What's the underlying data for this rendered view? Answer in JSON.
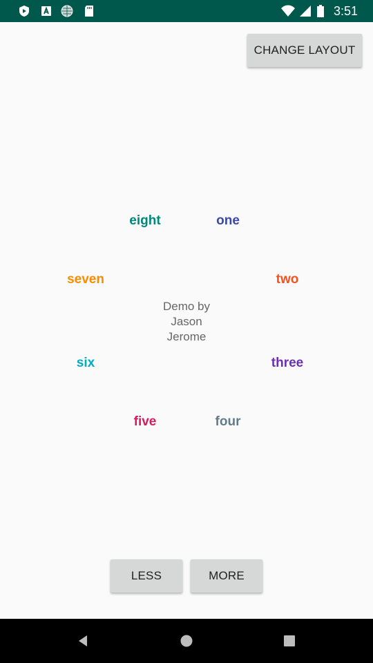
{
  "status_bar": {
    "time": "3:51",
    "left_icons": [
      "play-protect-icon",
      "font-a-icon",
      "globe-icon",
      "sd-card-icon"
    ],
    "right_icons": [
      "wifi-icon",
      "cell-signal-icon",
      "battery-icon"
    ],
    "background": "#00574b"
  },
  "toolbar": {
    "change_layout_label": "CHANGE LAYOUT"
  },
  "circle": {
    "center_text": [
      "Demo by",
      "Jason",
      "Jerome"
    ],
    "words": [
      {
        "label": "one",
        "color": "#3949ab"
      },
      {
        "label": "two",
        "color": "#f4511e"
      },
      {
        "label": "three",
        "color": "#6a30b5"
      },
      {
        "label": "four",
        "color": "#607d8b"
      },
      {
        "label": "five",
        "color": "#d81b60"
      },
      {
        "label": "six",
        "color": "#00acc1"
      },
      {
        "label": "seven",
        "color": "#fb8c00"
      },
      {
        "label": "eight",
        "color": "#00897b"
      }
    ]
  },
  "controls": {
    "less_label": "LESS",
    "more_label": "MORE"
  },
  "nav_bar": {
    "icons": [
      "back-icon",
      "home-icon",
      "recents-icon"
    ]
  }
}
